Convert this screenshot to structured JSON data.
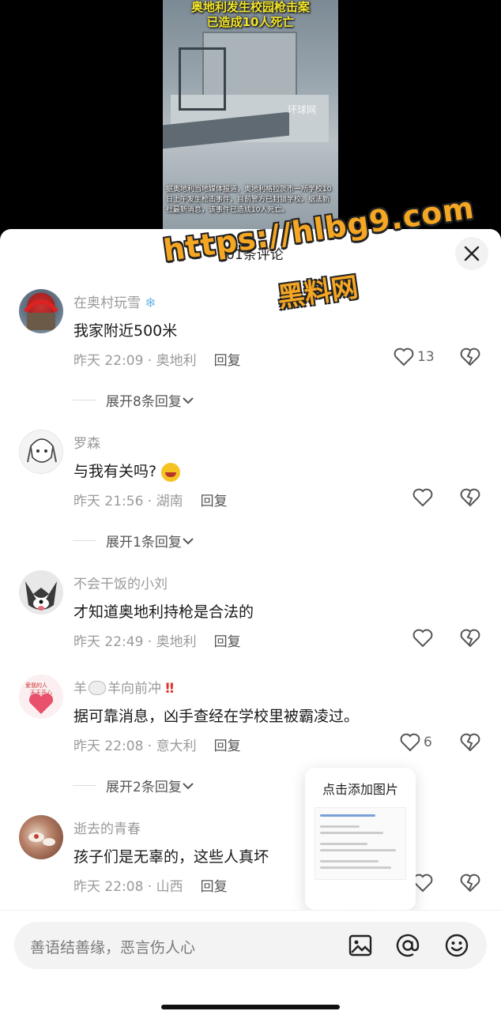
{
  "video": {
    "headline": "奥地利发生校园枪击案\n已造成10人死亡",
    "caption": "据奥地利当地媒体报道，奥地利格拉茨市一所学校10日上午发生枪击事件，目前警方已封锁学校。据法新社最新消息，该事件已造成10人死亡。",
    "logo": "环球网"
  },
  "sheet": {
    "title": "101条评论"
  },
  "watermark": {
    "url": "https://hlbg9.com",
    "name": "黑料网"
  },
  "comments": [
    {
      "user": "在奥村玩雪",
      "text": "我家附近500米",
      "time": "昨天 22:09 · 奥地利",
      "reply": "回复",
      "likes": "13",
      "expand": "展开8条回复"
    },
    {
      "user": "罗森",
      "text": "与我有关吗?",
      "time": "昨天 21:56 · 湖南",
      "reply": "回复",
      "likes": "",
      "expand": "展开1条回复"
    },
    {
      "user": "不会干饭的小刘",
      "text": "才知道奥地利持枪是合法的",
      "time": "昨天 22:49 · 奥地利",
      "reply": "回复",
      "likes": "",
      "expand": ""
    },
    {
      "user": "羊",
      "user_suffix": "羊向前冲",
      "text": "据可靠消息，凶手查经在学校里被霸凌过。",
      "time": "昨天 22:08 · 意大利",
      "reply": "回复",
      "likes": "6",
      "expand": "展开2条回复"
    },
    {
      "user": "逝去的青春",
      "text": "孩子们是无辜的，这些人真坏",
      "time": "昨天 22:08 · 山西",
      "reply": "回复",
      "likes": "",
      "expand": ""
    }
  ],
  "popup": {
    "title": "点击添加图片"
  },
  "input": {
    "placeholder": "善语结善缘，恶言伤人心"
  },
  "icons": [
    "close-icon",
    "heart-icon",
    "broken-heart-icon",
    "chevron-down-icon",
    "image-icon",
    "at-icon",
    "emoji-icon"
  ]
}
